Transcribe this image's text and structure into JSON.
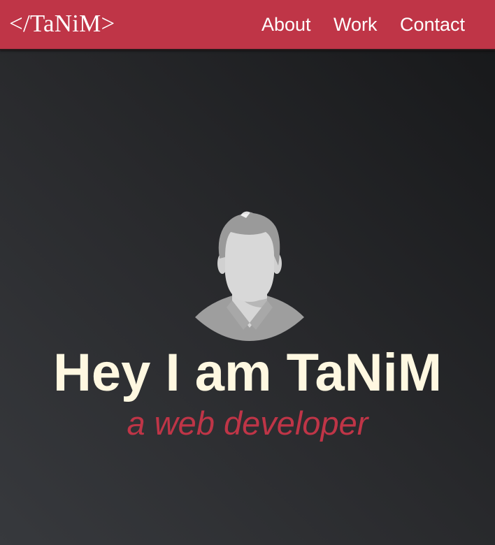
{
  "navbar": {
    "logo_text": "</TaNiM>",
    "links": [
      {
        "label": "About"
      },
      {
        "label": "Work"
      },
      {
        "label": "Contact"
      }
    ]
  },
  "hero": {
    "avatar_icon": "user-avatar-icon",
    "headline": "Hey I am TaNiM",
    "subtitle": "a web developer"
  },
  "colors": {
    "accent": "#bf3547",
    "headline": "#fff8e1",
    "background_dark": "#1b1c1e",
    "background_light": "#37393d"
  }
}
